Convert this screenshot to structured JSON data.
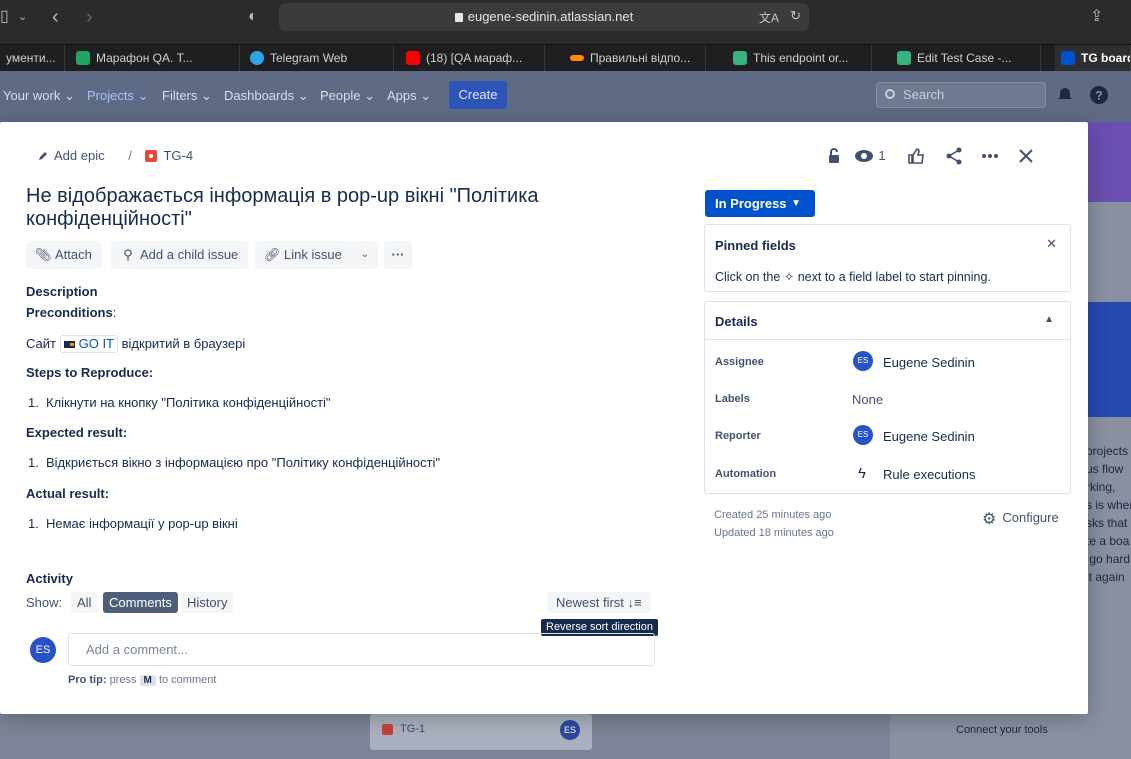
{
  "browser": {
    "url": "eugene-sedinin.atlassian.net",
    "tabs": [
      {
        "label": "ументи...",
        "color": "#4a4a4a"
      },
      {
        "label": "Марафон QA. Т...",
        "color": "#1fa463"
      },
      {
        "label": "Telegram Web",
        "color": "#2ca5e0"
      },
      {
        "label": "(18) [QA мараф...",
        "color": "#ff0000"
      },
      {
        "label": "Правильні відпо...",
        "color": "#ff8b00"
      },
      {
        "label": "This endpoint or...",
        "color": "#36b37e"
      },
      {
        "label": "Edit Test Case -...",
        "color": "#36b37e"
      },
      {
        "label": "TG board",
        "color": "#0052cc"
      }
    ]
  },
  "nav": {
    "your_work": "Your work ⌄",
    "projects": "Projects ⌄",
    "filters": "Filters ⌄",
    "dashboards": "Dashboards ⌄",
    "people": "People ⌄",
    "apps": "Apps ⌄",
    "create": "Create",
    "search_placeholder": "Search"
  },
  "background": {
    "card_key": "TG-1",
    "right_text": "projects\nus flow\nrking,\ns is when\nsks that\nte a boa\n go hard\nit again",
    "connect": "Connect your tools"
  },
  "issue": {
    "add_epic": "Add epic",
    "key": "TG-4",
    "watchers": "1",
    "title": "Не відображається інформація в pop-up вікні \"Політика конфіденційності\"",
    "actions": {
      "attach": "Attach",
      "add_child": "Add a child issue",
      "link": "Link issue"
    },
    "description": {
      "heading": "Description",
      "preconditions": "Preconditions",
      "site_prefix": "Сайт",
      "site_link": "GO IT",
      "site_suffix": "відкритий в браузері",
      "steps_heading": "Steps to Reproduce:",
      "step1": "Клікнути на кнопку  \"Політика конфіденційності\"",
      "expected_heading": "Expected result:",
      "expected1": "Відкриється вікно з інформацією про \"Політику конфіденційності\"",
      "actual_heading": "Actual result:",
      "actual1": "Немає інформації у pop-up вікні"
    },
    "activity": {
      "heading": "Activity",
      "show": "Show:",
      "all": "All",
      "comments": "Comments",
      "history": "History",
      "sort": "Newest first ↓≡",
      "tooltip": "Reverse sort direction",
      "comment_placeholder": "Add a comment...",
      "protip_label": "Pro tip:",
      "protip_press": "press",
      "protip_key": "M",
      "protip_rest": "to comment"
    },
    "status": "In Progress",
    "pinned": {
      "title": "Pinned fields",
      "hint": "Click on the ✧ next to a field label to start pinning."
    },
    "details": {
      "title": "Details",
      "assignee_label": "Assignee",
      "assignee": "Eugene Sedinin",
      "labels_label": "Labels",
      "labels": "None",
      "reporter_label": "Reporter",
      "reporter": "Eugene Sedinin",
      "automation_label": "Automation",
      "automation": "Rule executions",
      "initials": "ES"
    },
    "created": "Created 25 minutes ago",
    "updated": "Updated 18 minutes ago",
    "configure": "Configure"
  }
}
